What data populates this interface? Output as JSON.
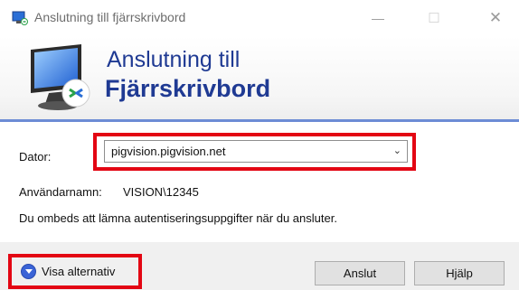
{
  "window": {
    "title": "Anslutning till fjärrskrivbord",
    "minimize_glyph": "—",
    "maximize_glyph": "☐",
    "close_glyph": "✕"
  },
  "banner": {
    "line1": "Anslutning till",
    "line2": "Fjärrskrivbord"
  },
  "form": {
    "computer_label": "Dator:",
    "computer_value": "pigvision.pigvision.net",
    "username_label": "Användarnamn:",
    "username_value": "VISION\\12345",
    "info_text": "Du ombeds att lämna autentiseringsuppgifter när du ansluter."
  },
  "footer": {
    "options_label": "Visa alternativ",
    "connect_label": "Anslut",
    "help_label": "Hjälp"
  },
  "colors": {
    "highlight": "#e30613",
    "brand_blue": "#1f3a93",
    "divider": "#6c8cd5"
  },
  "icons": {
    "app": "remote-desktop-icon",
    "dropdown": "chevron-down-icon",
    "options": "expand-options-icon"
  }
}
